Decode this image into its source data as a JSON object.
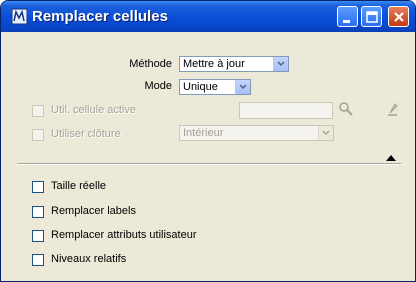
{
  "window": {
    "title": "Remplacer cellules"
  },
  "methode": {
    "label": "Méthode",
    "value": "Mettre à jour"
  },
  "mode": {
    "label": "Mode",
    "value": "Unique"
  },
  "active_cell": {
    "label": "Util. cellule active",
    "enabled": false
  },
  "fences": {
    "label": "Utiliser clôture",
    "value": "Intérieur",
    "enabled": false
  },
  "options": [
    {
      "label": "Taille réelle",
      "checked": false
    },
    {
      "label": "Remplacer labels",
      "checked": false
    },
    {
      "label": "Remplacer attributs utilisateur",
      "checked": false
    },
    {
      "label": "Niveaux relatifs",
      "checked": false
    }
  ],
  "icons": {
    "app": "cell-replace-icon",
    "search": "magnifier-icon",
    "pick": "pick-cell-icon",
    "collapse": "triangle-up-icon"
  }
}
